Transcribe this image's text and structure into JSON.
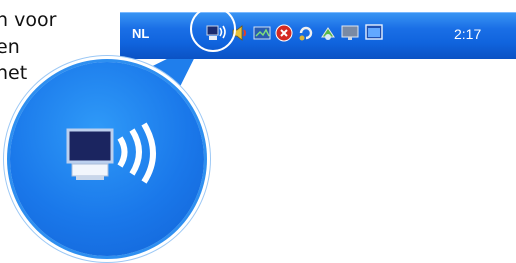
{
  "document": {
    "lines": [
      "n voor",
      "en",
      "het"
    ]
  },
  "taskbar": {
    "language": "NL",
    "clock": "2:17",
    "tray_icons": [
      "wireless-network-icon",
      "volume-icon",
      "monitor-icon",
      "security-shield-icon",
      "update-icon",
      "device-icon",
      "display-settings-icon",
      "window-icon"
    ]
  },
  "magnifier": {
    "icon": "wireless-network-icon"
  },
  "colors": {
    "taskbar_blue": "#1a6fe6",
    "highlight": "#ffffff"
  }
}
